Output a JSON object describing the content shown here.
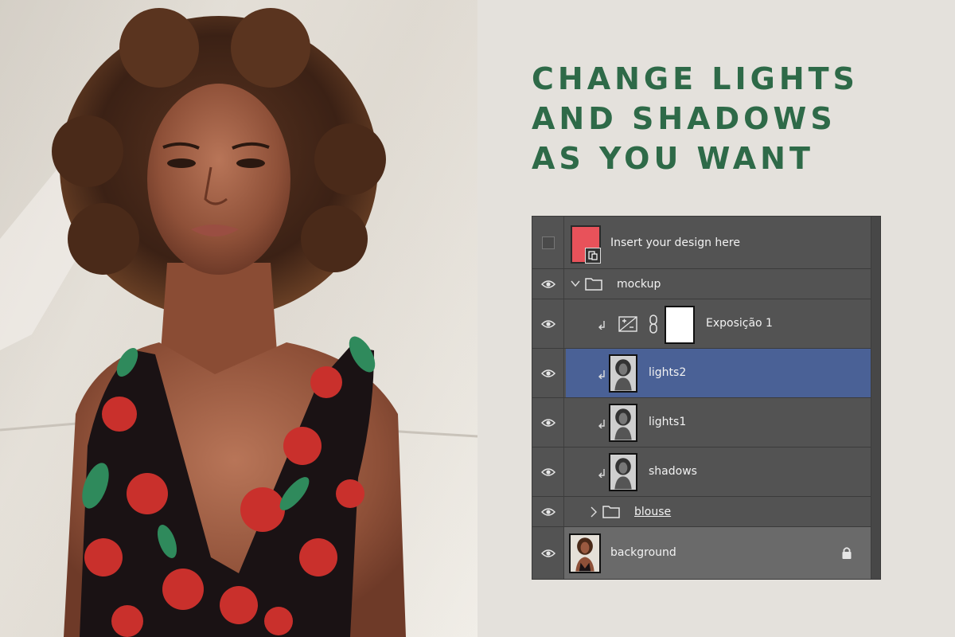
{
  "headline": {
    "line1": "CHANGE LIGHTS",
    "line2": "AND SHADOWS",
    "line3": "AS YOU WANT"
  },
  "colors": {
    "headline": "#2e6a48",
    "panel_bg": "#535353",
    "selected_row": "#4a6196",
    "design_thumb": "#e8525a",
    "page_bg": "#e4e1dc"
  },
  "layers_panel": {
    "layers": [
      {
        "name": "Insert your design here",
        "visible": false,
        "thumb": "smart-object-red"
      },
      {
        "name": "mockup",
        "visible": true,
        "type": "group",
        "expanded": true
      },
      {
        "name": "Exposição 1",
        "visible": true,
        "type": "adjustment",
        "clipped": true
      },
      {
        "name": "lights2",
        "visible": true,
        "clipped": true,
        "selected": true
      },
      {
        "name": "lights1",
        "visible": true,
        "clipped": true
      },
      {
        "name": "shadows",
        "visible": true,
        "clipped": true
      },
      {
        "name": "blouse",
        "visible": true,
        "type": "group",
        "expanded": false
      },
      {
        "name": "background",
        "visible": true,
        "locked": true
      }
    ]
  },
  "icons": [
    "eye-icon",
    "folder-icon",
    "chevron-down-icon",
    "chevron-right-icon",
    "exposure-icon",
    "link-icon",
    "lock-icon",
    "clip-arrow-icon",
    "smart-object-icon"
  ]
}
